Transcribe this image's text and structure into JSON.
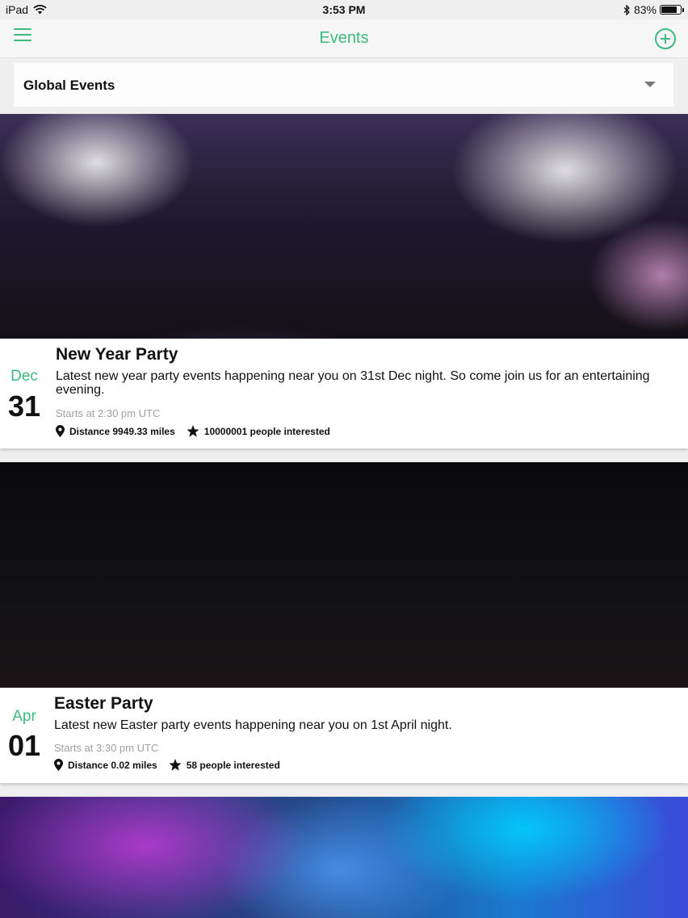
{
  "status_bar": {
    "device": "iPad",
    "time": "3:53 PM",
    "battery": "83%",
    "battery_level": 0.83
  },
  "nav": {
    "title": "Events",
    "menu_icon": "hamburger-icon",
    "add_icon": "plus-circle-icon"
  },
  "selector": {
    "label": "Global Events",
    "icon": "caret-down-icon"
  },
  "accent_color": "#3dba7e",
  "events": [
    {
      "month": "Dec",
      "day": "31",
      "title": "New Year Party",
      "description": "Latest new year party events happening near you on 31st Dec night. So come join us for an entertaining evening.",
      "starts": "Starts at 2:30 pm UTC",
      "distance": "Distance 9949.33 miles",
      "interested": "10000001 people interested"
    },
    {
      "month": "Apr",
      "day": "01",
      "title": "Easter Party",
      "description": "Latest new Easter party events happening near you on 1st April night.",
      "starts": "Starts at 3:30 pm UTC",
      "distance": "Distance 0.02 miles",
      "interested": "58 people interested"
    }
  ]
}
